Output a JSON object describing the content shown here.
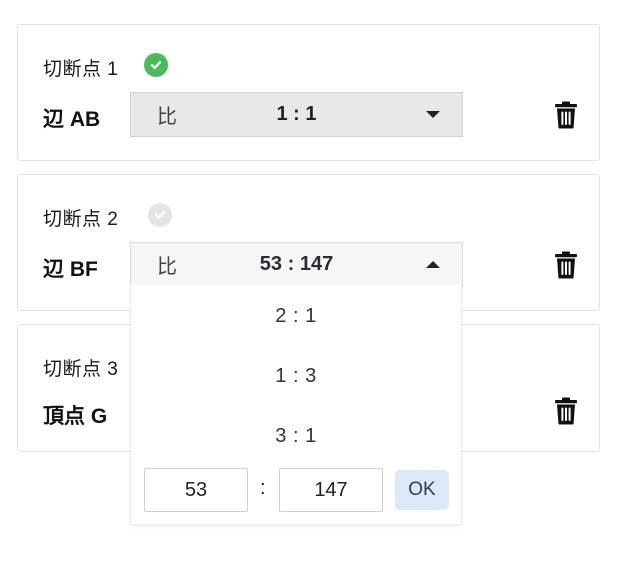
{
  "cut_points": [
    {
      "title": "切断点 1",
      "status": "complete",
      "edge": "辺 AB",
      "ratio_prefix": "比",
      "ratio_value": "1 : 1"
    },
    {
      "title": "切断点 2",
      "status": "incomplete",
      "edge": "辺 BF",
      "ratio_prefix": "比",
      "ratio_value": "53 : 147"
    },
    {
      "title": "切断点 3",
      "edge": "頂点 G"
    }
  ],
  "dropdown": {
    "options": [
      "2 : 1",
      "1 : 3",
      "3 : 1"
    ],
    "custom_left": "53",
    "custom_separator": ":",
    "custom_right": "147",
    "ok_label": "OK"
  },
  "colors": {
    "check_complete": "#4cb95c",
    "check_incomplete": "#e4e4e4",
    "select_bg": "#e6e8ec",
    "ok_button_bg": "#dde8f6"
  },
  "icons": [
    "check-circle-icon",
    "trash-icon",
    "caret-down-icon",
    "caret-up-icon"
  ]
}
